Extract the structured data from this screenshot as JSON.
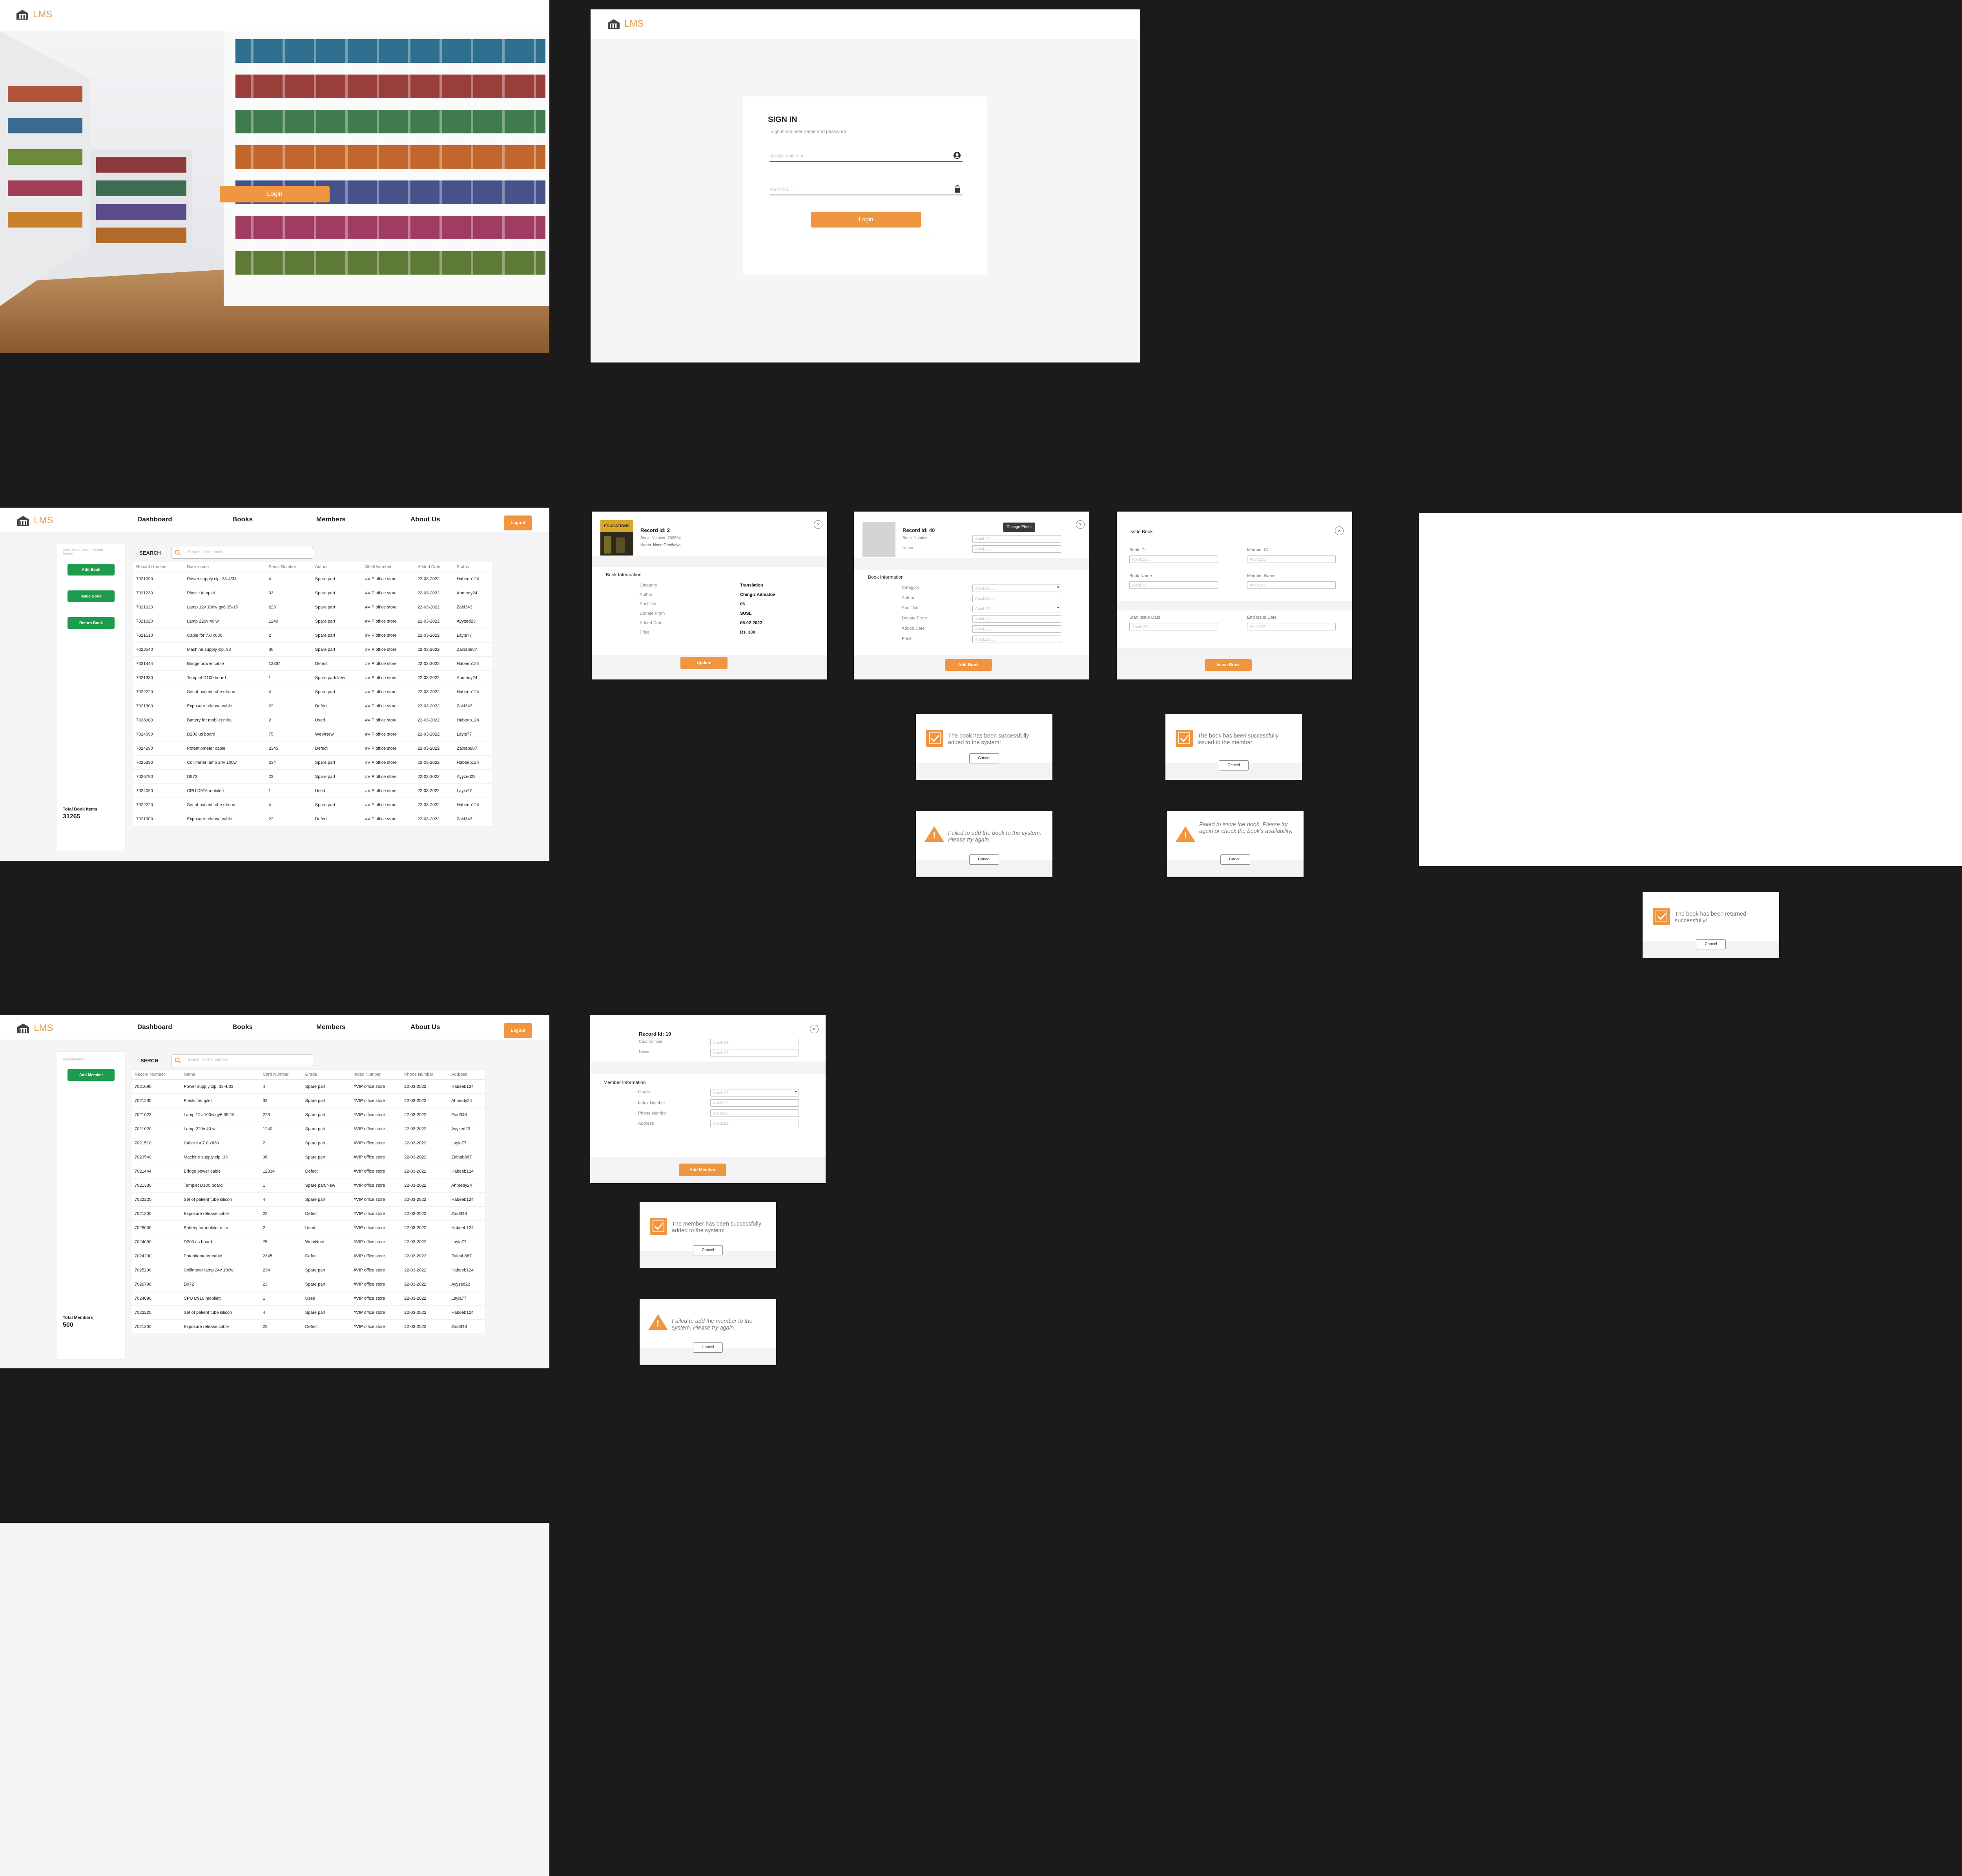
{
  "brand": {
    "name": "LMS",
    "accent": "#f09540",
    "success": "#1d9c4e",
    "bg": "#1b1b1b"
  },
  "landing": {
    "login_label": "Login"
  },
  "signin": {
    "title": "SIGN IN",
    "subtitle": "Sign in via user name and password",
    "email_placeholder": "abc@gmail.com",
    "password_placeholder": "Asd2225....",
    "login_label": "Login"
  },
  "nav": {
    "dashboard": "Dashboard",
    "books": "Books",
    "members": "Members",
    "about": "About Us",
    "logout": "Logout"
  },
  "books_page": {
    "side_hint": "Add / Issue Book / Return Books",
    "add_book": "Add Book",
    "issue_book": "Issue Book",
    "return_book": "Return Book",
    "total_label": "Total Book Items",
    "total_value": "31265",
    "search_label": "SEARCH",
    "search_placeholder": "Search for the book",
    "columns": [
      "Record Number",
      "Book name",
      "Serial Number",
      "Author",
      "Shelf Number",
      "Added Date",
      "Status"
    ],
    "rows": [
      [
        "7021090",
        "Power supply clp. 33-4/33",
        "4",
        "Spare part",
        "#VIP office store",
        "22-03-2022",
        "Habeeb124"
      ],
      [
        "7021230",
        "Plastic templet",
        "33",
        "Spare part",
        "#VIP office store",
        "22-03-2022",
        "Ahmedy24"
      ],
      [
        "7021023",
        "Lamp 12v 100w gy6.35-15",
        "223",
        "Spare part",
        "#VIP office store",
        "22-03-2022",
        "Zaid343"
      ],
      [
        "7021020",
        "Lamp 220v 40 w",
        "1240",
        "Spare part",
        "#VIP office store",
        "22-03-2022",
        "Ayyzed23"
      ],
      [
        "7021510",
        "Cable for 7.0 x630",
        "2",
        "Spare part",
        "#VIP office store",
        "22-03-2022",
        "Layla77"
      ],
      [
        "7023540",
        "Machine supply clp. 33",
        "36",
        "Spare part",
        "#VIP office store",
        "22-03-2022",
        "Zainab887"
      ],
      [
        "7021444",
        "Bridge power cable",
        "12334",
        "Defect",
        "#VIP office store",
        "22-03-2022",
        "Habeeb124"
      ],
      [
        "7021330",
        "Templet D100 board",
        "1",
        "Spare part/New",
        "#VIP office store",
        "22-03-2022",
        "Ahmedy24"
      ],
      [
        "7022220",
        "Set of patient tube silicon",
        "4",
        "Spare part",
        "#VIP office store",
        "22-03-2022",
        "Habeeb124"
      ],
      [
        "7021300",
        "Exposure release cable",
        "22",
        "Defect",
        "#VIP office store",
        "22-03-2022",
        "Zaid343"
      ],
      [
        "7028000",
        "Battery for mobilet mira",
        "2",
        "Used",
        "#VIP office store",
        "22-03-2022",
        "Habeeb124"
      ],
      [
        "7024090",
        "D200 us board",
        "75",
        "Web/New",
        "#VIP office store",
        "22-03-2022",
        "Layla77"
      ],
      [
        "7024290",
        "Potentiometer cable",
        "2345",
        "Defect",
        "#VIP office store",
        "22-03-2022",
        "Zainab887"
      ],
      [
        "7025290",
        "Collimeter lamp 24v 100w",
        "234",
        "Spare part",
        "#VIP office store",
        "22-03-2022",
        "Habeeb124"
      ],
      [
        "7026790",
        "D972",
        "23",
        "Spare part",
        "#VIP office store",
        "22-03-2022",
        "Ayyzed23"
      ],
      [
        "7024090",
        "CPU D916 mobilett",
        "1",
        "Used",
        "#VIP office store",
        "22-03-2022",
        "Layla77"
      ],
      [
        "7022220",
        "Set of patient tube silicon",
        "4",
        "Spare part",
        "#VIP office store",
        "22-03-2022",
        "Habeeb124"
      ],
      [
        "7021300",
        "Exposure release cable",
        "22",
        "Defect",
        "#VIP office store",
        "22-03-2022",
        "Zaid343"
      ]
    ]
  },
  "members_page": {
    "side_hint": "Add Members",
    "add_member": "Add Member",
    "total_label": "Total Members",
    "total_value": "500",
    "search_label": "SERCH",
    "search_placeholder": "Search for the member",
    "columns": [
      "Record Number",
      "Name",
      "Card Number",
      "Grade",
      "Index Number",
      "Phone Number",
      "Address"
    ],
    "rows": [
      [
        "7021090",
        "Power supply clp. 33-4/33",
        "4",
        "Spare part",
        "#VIP office store",
        "22-03-2022",
        "Habeeb124"
      ],
      [
        "7021230",
        "Plastic templet",
        "33",
        "Spare part",
        "#VIP office store",
        "22-03-2022",
        "Ahmedy24"
      ],
      [
        "7021023",
        "Lamp 12v 100w gy6.35-15",
        "223",
        "Spare part",
        "#VIP office store",
        "22-03-2022",
        "Zaid343"
      ],
      [
        "7021020",
        "Lamp 220v 40 w",
        "1240",
        "Spare part",
        "#VIP office store",
        "22-03-2022",
        "Ayyzed23"
      ],
      [
        "7021510",
        "Cable for 7.0 x630",
        "2",
        "Spare part",
        "#VIP office store",
        "22-03-2022",
        "Layla77"
      ],
      [
        "7023540",
        "Machine supply clp. 33",
        "36",
        "Spare part",
        "#VIP office store",
        "22-03-2022",
        "Zainab887"
      ],
      [
        "7021444",
        "Bridge power cable",
        "12334",
        "Defect",
        "#VIP office store",
        "22-03-2022",
        "Habeeb124"
      ],
      [
        "7021330",
        "Templet D100 board",
        "1",
        "Spare part/New",
        "#VIP office store",
        "22-03-2022",
        "Ahmedy24"
      ],
      [
        "7022220",
        "Set of patient tube silicon",
        "4",
        "Spare part",
        "#VIP office store",
        "22-03-2022",
        "Habeeb124"
      ],
      [
        "7021300",
        "Exposure release cable",
        "22",
        "Defect",
        "#VIP office store",
        "22-03-2022",
        "Zaid343"
      ],
      [
        "7028000",
        "Battery for mobilet mira",
        "2",
        "Used",
        "#VIP office store",
        "22-03-2022",
        "Habeeb124"
      ],
      [
        "7024090",
        "D200 us board",
        "75",
        "Web/New",
        "#VIP office store",
        "22-03-2022",
        "Layla77"
      ],
      [
        "7024290",
        "Potentiometer cable",
        "2345",
        "Defect",
        "#VIP office store",
        "22-03-2022",
        "Zainab887"
      ],
      [
        "7025290",
        "Collimeter lamp 24v 100w",
        "234",
        "Spare part",
        "#VIP office store",
        "22-03-2022",
        "Habeeb124"
      ],
      [
        "7026790",
        "D972",
        "23",
        "Spare part",
        "#VIP office store",
        "22-03-2022",
        "Ayyzed23"
      ],
      [
        "7024090",
        "CPU D916 mobilett",
        "1",
        "Used",
        "#VIP office store",
        "22-03-2022",
        "Layla77"
      ],
      [
        "7022220",
        "Set of patient tube silicon",
        "4",
        "Spare part",
        "#VIP office store",
        "22-03-2022",
        "Habeeb124"
      ],
      [
        "7021300",
        "Exposure release cable",
        "22",
        "Defect",
        "#VIP office store",
        "22-03-2022",
        "Zaid343"
      ]
    ]
  },
  "book_detail": {
    "record_id": "Record Id: 2",
    "serial": "Serial Number: 239504",
    "name": "Name: Nene Geethaya",
    "cover_text": "EDUCATIONS",
    "section": "Book Information",
    "labels": [
      "Category",
      "Author",
      "Shelf No.",
      "Donate From",
      "Added Date",
      "Price"
    ],
    "values": [
      "Translation",
      "Chingiz Aitmatov",
      "06",
      "SUSL",
      "05-02-2022",
      "Rs. 300"
    ],
    "update_label": "Update"
  },
  "add_book": {
    "record_id": "Record Id: 40",
    "change_photo": "Change Photo",
    "serial_label": "Serial Number",
    "name_label": "Name",
    "section": "Book Information",
    "labels": [
      "Category",
      "Author",
      "Shelf No.",
      "Donate From",
      "Added Date",
      "Price"
    ],
    "placeholder": "Abcd123...",
    "add_label": "Add Book"
  },
  "issue_book": {
    "title": "Issue Book",
    "book_id": "Book ID",
    "member_id": "Member ID",
    "book_name": "Book Name",
    "member_name": "Member Name",
    "start_date": "Start Issue Date",
    "end_date": "End Issue Date",
    "placeholder": "Abcd123...",
    "issue_label": "Issue Book"
  },
  "add_member": {
    "record_id": "Record Id: 10",
    "card_label": "Card Number",
    "name_label": "Name",
    "section": "Member Information",
    "labels": [
      "Grade",
      "Index Number",
      "Phone Number",
      "Address"
    ],
    "placeholder": "Abcd123...",
    "add_label": "Add Member"
  },
  "messages": {
    "book_added": "The book has been successfully added to the system!",
    "book_issued": "The book has been successfully issued to the member!",
    "book_add_failed": "Failed to add the book to the system. Please try again.",
    "book_issue_failed": "Failed to issue the book. Please try again or check the book's availability.",
    "book_returned": "The book has been returned successfully!",
    "member_added": "The member has been successfully added to the system!",
    "member_add_failed": "Failed to add the member to the system. Please try again.",
    "cancel": "Cancel"
  }
}
